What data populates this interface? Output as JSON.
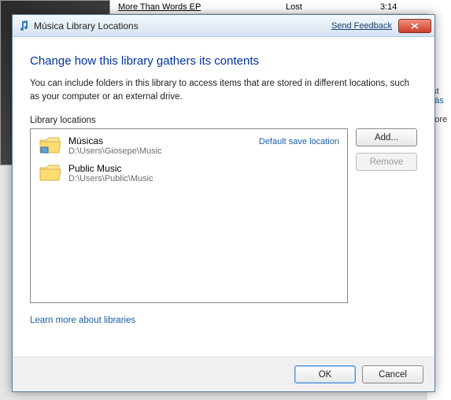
{
  "background": {
    "track_title": "More Than Words EP",
    "track_status": "Lost",
    "track_duration": "3:14",
    "side_text1": "ost",
    "side_link": "Más C",
    "side_text2": "More"
  },
  "dialog": {
    "title": "Música Library Locations",
    "feedback_link": "Send Feedback",
    "heading": "Change how this library gathers its contents",
    "description": "You can include folders in this library to access items that are stored in different locations, such as your computer or an external drive.",
    "section_label": "Library locations",
    "locations": [
      {
        "name": "Músicas",
        "path": "D:\\Users\\Giosepe\\Music",
        "badge": "Default save location"
      },
      {
        "name": "Public Music",
        "path": "D:\\Users\\Public\\Music",
        "badge": ""
      }
    ],
    "add_button": "Add...",
    "remove_button": "Remove",
    "learn_more": "Learn more about libraries",
    "ok_button": "OK",
    "cancel_button": "Cancel"
  }
}
